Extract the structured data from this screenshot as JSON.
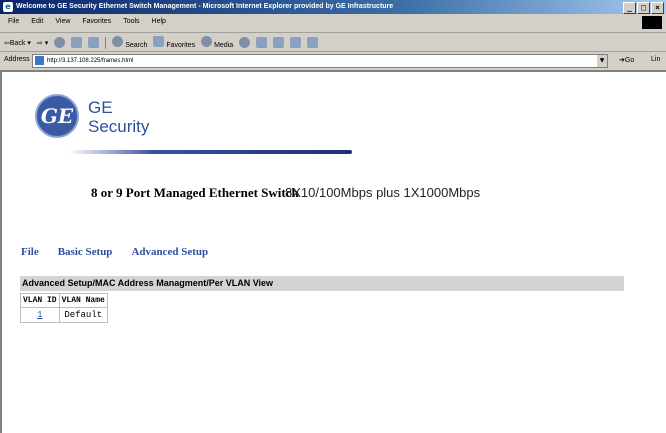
{
  "window": {
    "title": "Welcome to GE Security Ethernet Switch Management - Microsoft Internet Explorer provided by GE Infrastructure"
  },
  "menubar": {
    "items": [
      "File",
      "Edit",
      "View",
      "Favorites",
      "Tools",
      "Help"
    ]
  },
  "toolbar": {
    "back": "Back",
    "search": "Search",
    "favorites": "Favorites",
    "media": "Media"
  },
  "addressbar": {
    "label": "Address",
    "url": "http://3.137.108.225/frames.html",
    "go": "Go",
    "links": "Lin"
  },
  "page": {
    "brand_line1": "GE",
    "brand_line2": "Security",
    "logo_text": "GE",
    "heading": "8 or 9 Port Managed Ethernet Switch",
    "subheading": "8X10/100Mbps plus 1X1000Mbps",
    "nav": [
      "File",
      "Basic Setup",
      "Advanced Setup"
    ],
    "section_title": "Advanced Setup/MAC Address Managment/Per VLAN View",
    "table": {
      "headers": [
        "VLAN ID",
        "VLAN Name"
      ],
      "rows": [
        [
          "1",
          "Default"
        ]
      ]
    }
  },
  "colors": {
    "brand": "#2e4e9e",
    "section_bar": "#d4d4d4"
  }
}
